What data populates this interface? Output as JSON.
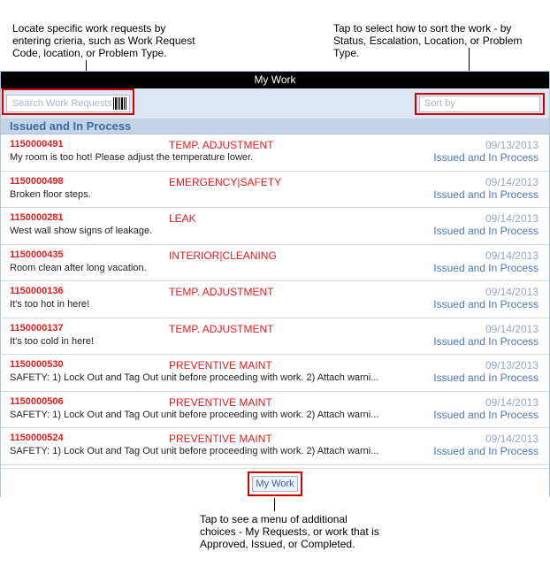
{
  "callouts": {
    "search": "Locate specific work requests by entering crieria, such as Work Request Code, location, or Problem Type.",
    "sort": "Tap to select how to sort the work -  by Status, Escalation, Location, or Problem Type.",
    "menu": "Tap to see a menu of additional choices - My Requests,  or work that is Approved, Issued, or Completed."
  },
  "app": {
    "title": "My Work",
    "search": {
      "placeholder": "Search Work Requests",
      "value": ""
    },
    "sort": {
      "placeholder": "Sort by"
    },
    "section_title": "Issued and In Process",
    "bottom_button": "My Work"
  },
  "colors": {
    "titlebar": "#000000",
    "toolbar": "#dde6f1",
    "section_header": "#c4d4e8",
    "code_red": "#e02020",
    "status_blue": "#4a78b5",
    "annotation_red": "#cc0000"
  },
  "icons": {
    "barcode": "barcode-icon"
  },
  "work_requests": [
    {
      "code": "1150000491",
      "type": "TEMP. ADJUSTMENT",
      "date": "09/13/2013",
      "description": "My room is too hot! Please adjust the temperature lower.",
      "status": "Issued and In Process"
    },
    {
      "code": "1150000498",
      "type": "EMERGENCY|SAFETY",
      "date": "09/14/2013",
      "description": "Broken floor steps.",
      "status": "Issued and In Process"
    },
    {
      "code": "1150000281",
      "type": "LEAK",
      "date": "09/14/2013",
      "description": "West wall show signs of leakage.",
      "status": "Issued and In Process"
    },
    {
      "code": "1150000435",
      "type": "INTERIOR|CLEANING",
      "date": "09/14/2013",
      "description": "Room clean after long vacation.",
      "status": "Issued and In Process"
    },
    {
      "code": "1150000136",
      "type": "TEMP. ADJUSTMENT",
      "date": "09/14/2013",
      "description": "It's too hot in here!",
      "status": "Issued and In Process"
    },
    {
      "code": "1150000137",
      "type": "TEMP. ADJUSTMENT",
      "date": "09/14/2013",
      "description": "It's too cold in here!",
      "status": "Issued and In Process"
    },
    {
      "code": "1150000530",
      "type": "PREVENTIVE MAINT",
      "date": "09/13/2013",
      "description": "SAFETY: 1) Lock Out and Tag Out unit before proceeding with work. 2) Attach warni...",
      "status": "Issued and In Process"
    },
    {
      "code": "1150000506",
      "type": "PREVENTIVE MAINT",
      "date": "09/14/2013",
      "description": "SAFETY: 1) Lock Out and Tag Out unit before proceeding with work. 2) Attach warni...",
      "status": "Issued and In Process"
    },
    {
      "code": "1150000524",
      "type": "PREVENTIVE MAINT",
      "date": "09/14/2013",
      "description": "SAFETY: 1) Lock Out and Tag Out unit before proceeding with work. 2) Attach warni...",
      "status": "Issued and In Process"
    }
  ]
}
